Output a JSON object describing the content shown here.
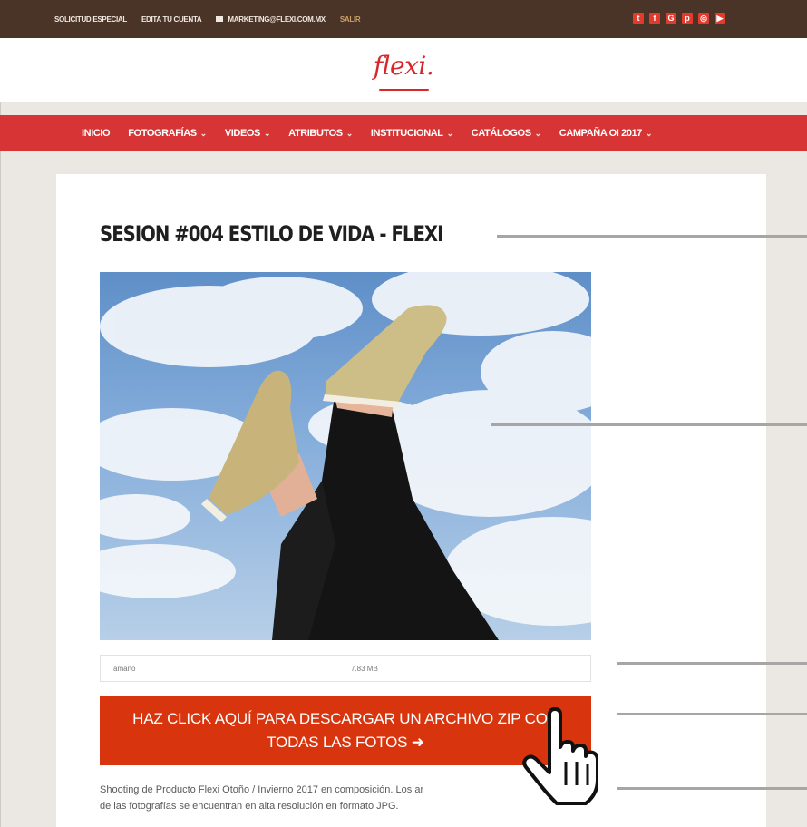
{
  "topbar": {
    "links": [
      "SOLICITUD ESPECIAL",
      "EDITA TU CUENTA"
    ],
    "email": "MARKETING@FLEXI.COM.MX",
    "logout": "SALIR",
    "social_icons": [
      "twitter-icon",
      "facebook-icon",
      "google-plus-icon",
      "pinterest-icon",
      "instagram-icon",
      "youtube-icon"
    ]
  },
  "header": {
    "logo": "flexi."
  },
  "nav": {
    "items": [
      {
        "label": "INICIO",
        "has_dropdown": false
      },
      {
        "label": "FOTOGRAFÍAS",
        "has_dropdown": true
      },
      {
        "label": "VIDEOS",
        "has_dropdown": true
      },
      {
        "label": "ATRIBUTOS",
        "has_dropdown": true
      },
      {
        "label": "INSTITUCIONAL",
        "has_dropdown": true
      },
      {
        "label": "CATÁLOGOS",
        "has_dropdown": true
      },
      {
        "label": "CAMPAÑA OI 2017",
        "has_dropdown": true
      }
    ],
    "chevron": "⌄"
  },
  "main": {
    "title": "SESION #004 ESTILO DE VIDA - FLEXI",
    "info": {
      "size_label": "Tamaño",
      "size_value": "7.83 MB"
    },
    "download_line1": "HAZ CLICK AQUÍ PARA DESCARGAR UN ARCHIVO ZIP CON",
    "download_line2": "TODAS LAS FOTOS ➜",
    "description_line1": "Shooting de Producto Flexi Otoño / Invierno 2017 en composición. Los ar",
    "description_line2": "de las fotografías se encuentran en alta resolución en formato JPG."
  },
  "colors": {
    "topbar": "#4a3428",
    "nav": "#d73535",
    "logo": "#d8262a",
    "button": "#d8350e",
    "background": "#ebe7e2"
  }
}
